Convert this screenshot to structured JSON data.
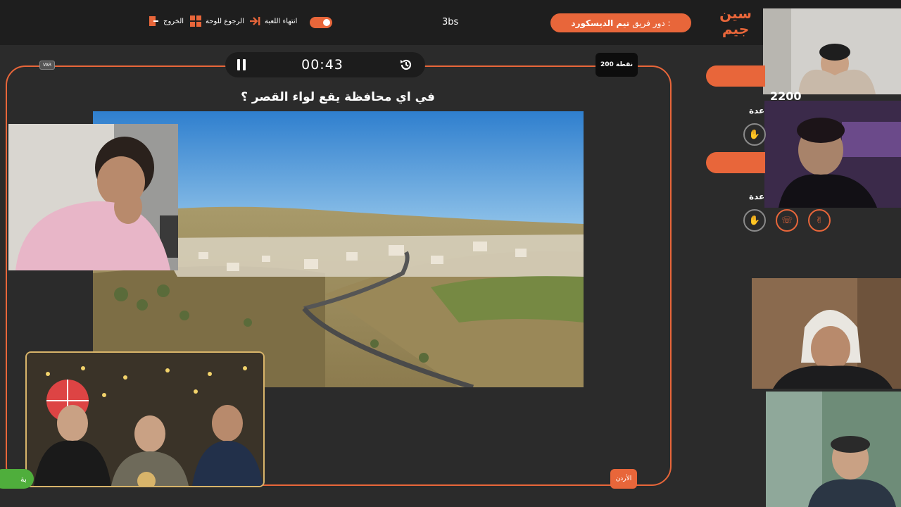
{
  "topbar": {
    "exit_label": "الخروج",
    "board_label": "الرجوع للوحة",
    "end_label": "انتهاء اللعبة",
    "channel": "3bs",
    "turn_prefix": "دور فريق :",
    "turn_team": "تيم الديسكورد",
    "logo_text": "سين جيم",
    "colors": {
      "accent": "#e8663a",
      "bar": "#1e1e1e"
    }
  },
  "game": {
    "timer": "00:43",
    "var_badge": "VAR",
    "points": "200 نقطة",
    "question": "في اي محافظة يقع لواء القصر ؟",
    "answer_tag": "الأردن"
  },
  "side": {
    "score": "2200",
    "label_1": "عدة",
    "label_2": "عدة",
    "green_chip": "بة",
    "icons": [
      "hand-icon",
      "hand-icon",
      "phone-icon",
      "peace-icon"
    ]
  }
}
